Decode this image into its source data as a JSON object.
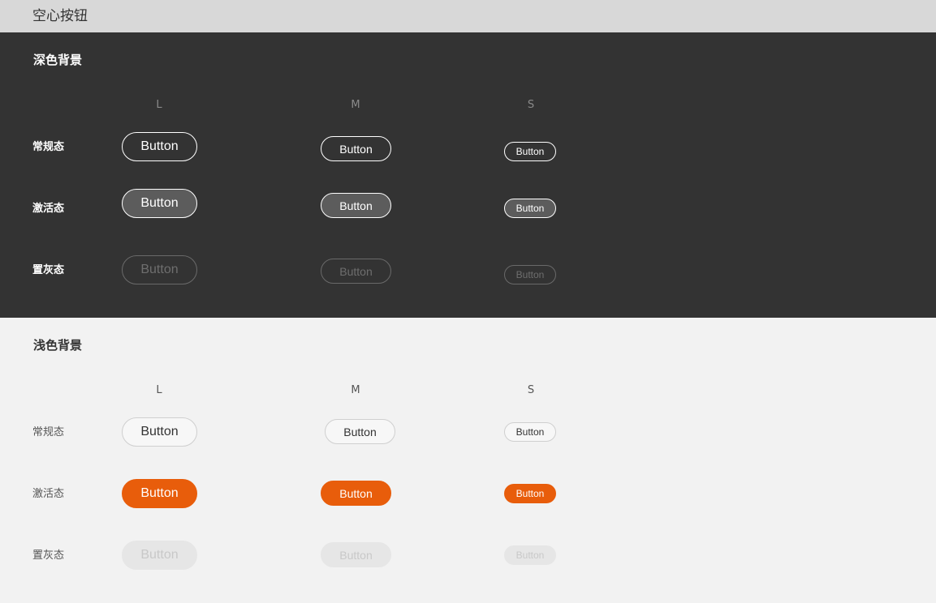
{
  "header": {
    "title": "空心按钮"
  },
  "dark": {
    "title": "深色背景",
    "columns": [
      "L",
      "M",
      "S"
    ],
    "rows": [
      "常规态",
      "激活态",
      "置灰态"
    ],
    "button_label": "Button"
  },
  "light": {
    "title": "浅色背景",
    "columns": [
      "L",
      "M",
      "S"
    ],
    "rows": [
      "常规态",
      "激活态",
      "置灰态"
    ],
    "button_label": "Button"
  },
  "colors": {
    "dark_bg": "#333333",
    "light_bg": "#f2f2f2",
    "accent": "#e85d0b",
    "header_bg": "#d8d8d8"
  }
}
